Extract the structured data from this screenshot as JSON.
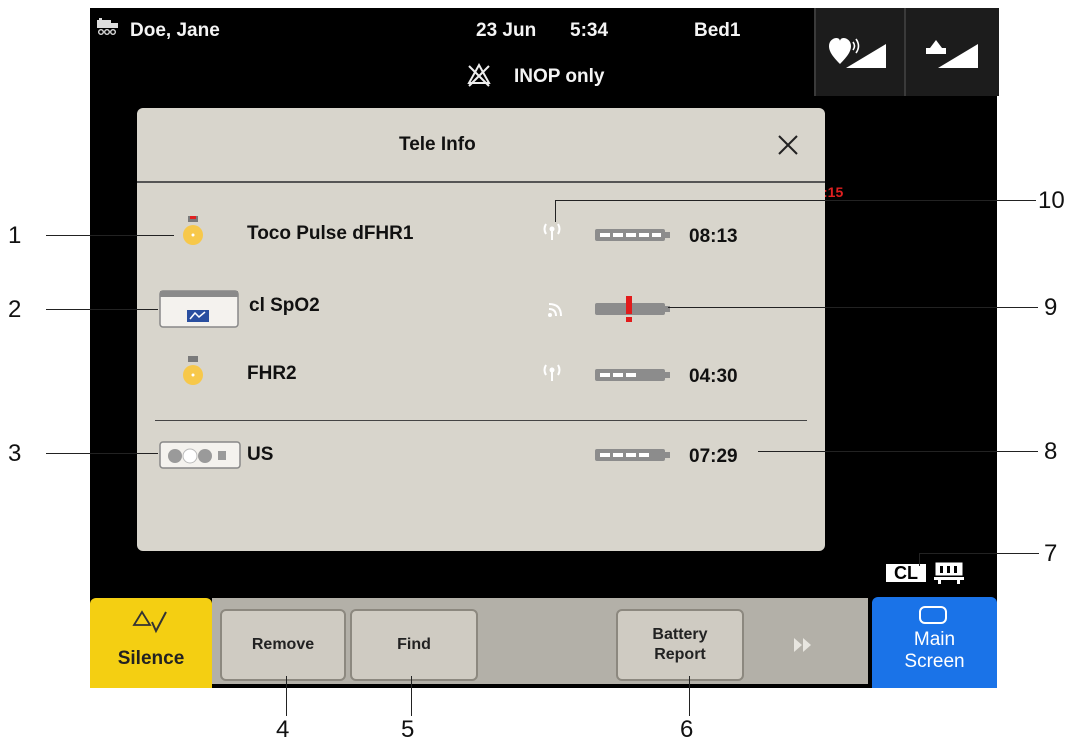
{
  "header": {
    "patient_name": "Doe, Jane",
    "date": "23 Jun",
    "time": "5:34",
    "bed": "Bed1",
    "alarm_status": "INOP only"
  },
  "dialog": {
    "title": "Tele Info",
    "partial_red_text": ":15",
    "devices": [
      {
        "label": "Toco Pulse dFHR1",
        "time": "08:13",
        "battery_fraction": 1.0
      },
      {
        "label": "cl SpO2",
        "time": "",
        "battery_fraction": 0.0,
        "battery_alert": "!"
      },
      {
        "label": "FHR2",
        "time": "04:30",
        "battery_fraction": 0.6
      },
      {
        "label": "US",
        "time": "07:29",
        "battery_fraction": 0.8
      }
    ]
  },
  "statusbar": {
    "cl_label": "CL"
  },
  "bottombar": {
    "silence_label": "Silence",
    "remove_label": "Remove",
    "find_label": "Find",
    "battery_report_label": "Battery\nReport",
    "main_screen_label": "Main\nScreen"
  },
  "callouts": [
    "1",
    "2",
    "3",
    "4",
    "5",
    "6",
    "7",
    "8",
    "9",
    "10"
  ]
}
